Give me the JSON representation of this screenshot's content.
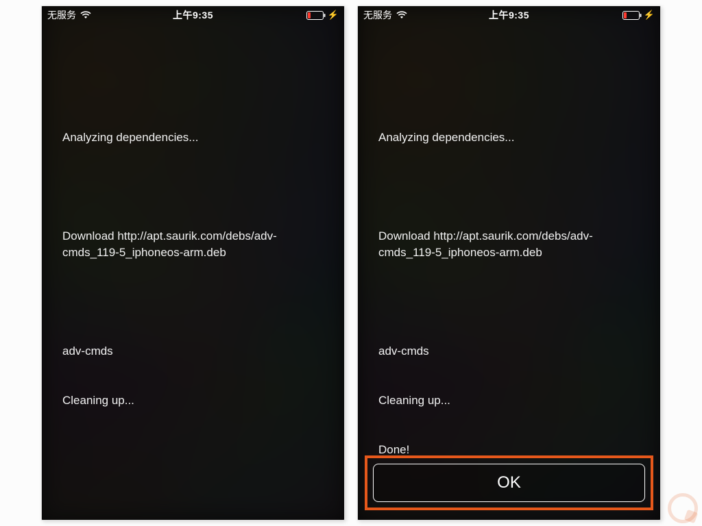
{
  "status": {
    "carrier": "无服务",
    "time": "上午9:35"
  },
  "left": {
    "lines": [
      "Analyzing dependencies...",
      "",
      "Download http://apt.saurik.com/debs/adv-cmds_119-5_iphoneos-arm.deb",
      "",
      "adv-cmds",
      "Cleaning up..."
    ]
  },
  "right": {
    "lines": [
      "Analyzing dependencies...",
      "",
      "Download http://apt.saurik.com/debs/adv-cmds_119-5_iphoneos-arm.deb",
      "",
      "adv-cmds",
      "Cleaning up...",
      "Done!"
    ],
    "ok_label": "OK"
  },
  "colors": {
    "highlight": "#e6581b",
    "battery": "#ff3b30"
  }
}
